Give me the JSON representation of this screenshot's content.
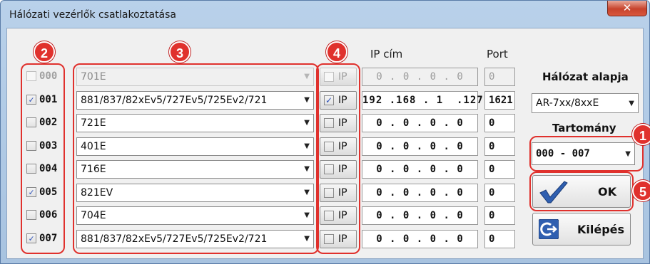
{
  "window": {
    "title": "Hálózati vezérlők csatlakoztatása",
    "close_glyph": "✕"
  },
  "badges": {
    "b1": "1",
    "b2": "2",
    "b3": "3",
    "b4": "4",
    "b5": "5"
  },
  "headers": {
    "ip": "IP cím",
    "port": "Port"
  },
  "ip_button_label": "IP",
  "rows": [
    {
      "num": "000",
      "checked": false,
      "enabled": false,
      "model": "701E",
      "ip_checked": false,
      "ip": "0 . 0 . 0 . 0",
      "port": "0"
    },
    {
      "num": "001",
      "checked": true,
      "enabled": true,
      "model": "881/837/82xEv5/727Ev5/725Ev2/721",
      "ip_checked": true,
      "ip": "192 .168 . 1  .127",
      "port": "1621"
    },
    {
      "num": "002",
      "checked": false,
      "enabled": true,
      "model": "721E",
      "ip_checked": false,
      "ip": "0 . 0 . 0 . 0",
      "port": "0"
    },
    {
      "num": "003",
      "checked": false,
      "enabled": true,
      "model": "401E",
      "ip_checked": false,
      "ip": "0 . 0 . 0 . 0",
      "port": "0"
    },
    {
      "num": "004",
      "checked": false,
      "enabled": true,
      "model": "716E",
      "ip_checked": false,
      "ip": "0 . 0 . 0 . 0",
      "port": "0"
    },
    {
      "num": "005",
      "checked": true,
      "enabled": true,
      "model": "821EV",
      "ip_checked": false,
      "ip": "0 . 0 . 0 . 0",
      "port": "0"
    },
    {
      "num": "006",
      "checked": false,
      "enabled": true,
      "model": "704E",
      "ip_checked": false,
      "ip": "0 . 0 . 0 . 0",
      "port": "0"
    },
    {
      "num": "007",
      "checked": true,
      "enabled": true,
      "model": "881/837/82xEv5/727Ev5/725Ev2/721",
      "ip_checked": false,
      "ip": "0 . 0 . 0 . 0",
      "port": "0"
    }
  ],
  "side": {
    "network_base_label": "Hálózat alapja",
    "network_base_value": "AR-7xx/8xxE",
    "range_label": "Tartomány",
    "range_value": "000 - 007",
    "ok_label": "OK",
    "exit_label": "Kilépés"
  },
  "colors": {
    "accent_red": "#e0312d",
    "check_blue": "#2a4fb8"
  }
}
